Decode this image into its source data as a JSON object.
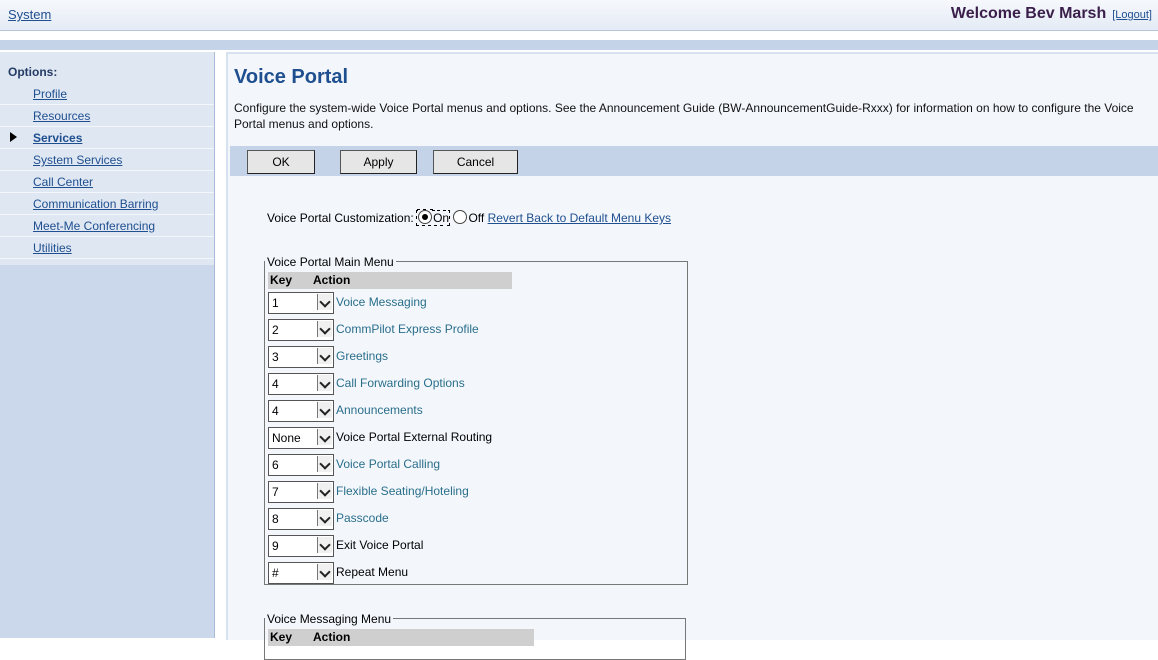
{
  "topbar": {
    "system_link": "System",
    "welcome": "Welcome Bev Marsh",
    "logout": "[Logout]"
  },
  "sidebar": {
    "heading": "Options:",
    "items": [
      {
        "label": "Profile"
      },
      {
        "label": "Resources"
      },
      {
        "label": "Services",
        "active": true
      },
      {
        "label": "System Services"
      },
      {
        "label": "Call Center"
      },
      {
        "label": "Communication Barring"
      },
      {
        "label": "Meet-Me Conferencing"
      },
      {
        "label": "Utilities"
      }
    ]
  },
  "main": {
    "title": "Voice Portal",
    "description": "Configure the system-wide Voice Portal menus and options. See the Announcement Guide (BW-AnnouncementGuide-Rxxx) for information on how to configure the Voice Portal menus and options.",
    "buttons": {
      "ok": "OK",
      "apply": "Apply",
      "cancel": "Cancel"
    },
    "customization": {
      "label": "Voice Portal Customization:",
      "on_label": "On",
      "off_label": "Off",
      "selected": "On",
      "revert_link": "Revert Back to Default Menu Keys"
    },
    "main_menu": {
      "legend": "Voice Portal Main Menu",
      "key_header": "Key",
      "action_header": "Action",
      "rows": [
        {
          "key": "1",
          "action": "Voice Messaging",
          "link": true
        },
        {
          "key": "2",
          "action": "CommPilot Express Profile",
          "link": true
        },
        {
          "key": "3",
          "action": "Greetings",
          "link": true
        },
        {
          "key": "4",
          "action": "Call Forwarding Options",
          "link": true
        },
        {
          "key": "4",
          "action": "Announcements",
          "link": true
        },
        {
          "key": "None",
          "action": "Voice Portal External Routing",
          "link": false
        },
        {
          "key": "6",
          "action": "Voice Portal Calling",
          "link": true
        },
        {
          "key": "7",
          "action": "Flexible Seating/Hoteling",
          "link": true
        },
        {
          "key": "8",
          "action": "Passcode",
          "link": true
        },
        {
          "key": "9",
          "action": "Exit Voice Portal",
          "link": false
        },
        {
          "key": "#",
          "action": "Repeat Menu",
          "link": false
        }
      ]
    },
    "messaging_menu": {
      "legend": "Voice Messaging Menu",
      "key_header": "Key",
      "action_header": "Action"
    }
  }
}
